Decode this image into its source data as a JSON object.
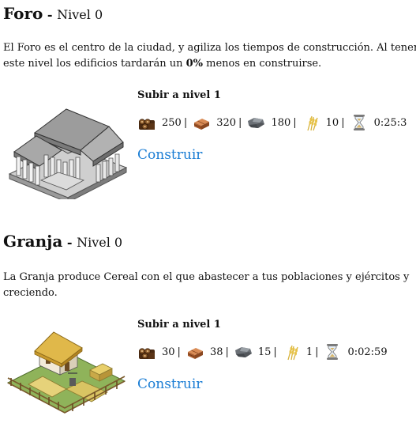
{
  "buildings": [
    {
      "name": "Foro",
      "separator": " - ",
      "level_text": "Nivel 0",
      "desc_part1": "El Foro es el centro de la ciudad, y agiliza los tiempos de construcción. Al tener",
      "desc_part2": "este nivel los edificios tardarán un ",
      "desc_bold": "0%",
      "desc_part3": " menos en construirse.",
      "upgrade_title": "Subir a nivel 1",
      "costs": {
        "wood": "250",
        "clay": "320",
        "iron": "180",
        "cereal": "10",
        "time": "0:25:3"
      },
      "build_label": "Construir"
    },
    {
      "name": "Granja",
      "separator": " - ",
      "level_text": "Nivel 0",
      "desc_part1": "La Granja produce Cereal con el que abastecer a tus poblaciones y ejércitos y",
      "desc_part2": "creciendo.",
      "upgrade_title": "Subir a nivel 1",
      "costs": {
        "wood": "30",
        "clay": "38",
        "iron": "15",
        "cereal": "1",
        "time": "0:02:59"
      },
      "build_label": "Construir"
    }
  ],
  "separator_char": "|",
  "colors": {
    "link": "#1a7dd4",
    "text": "#111111"
  },
  "icons": [
    "wood-icon",
    "clay-icon",
    "iron-icon",
    "cereal-icon",
    "hourglass-icon"
  ]
}
